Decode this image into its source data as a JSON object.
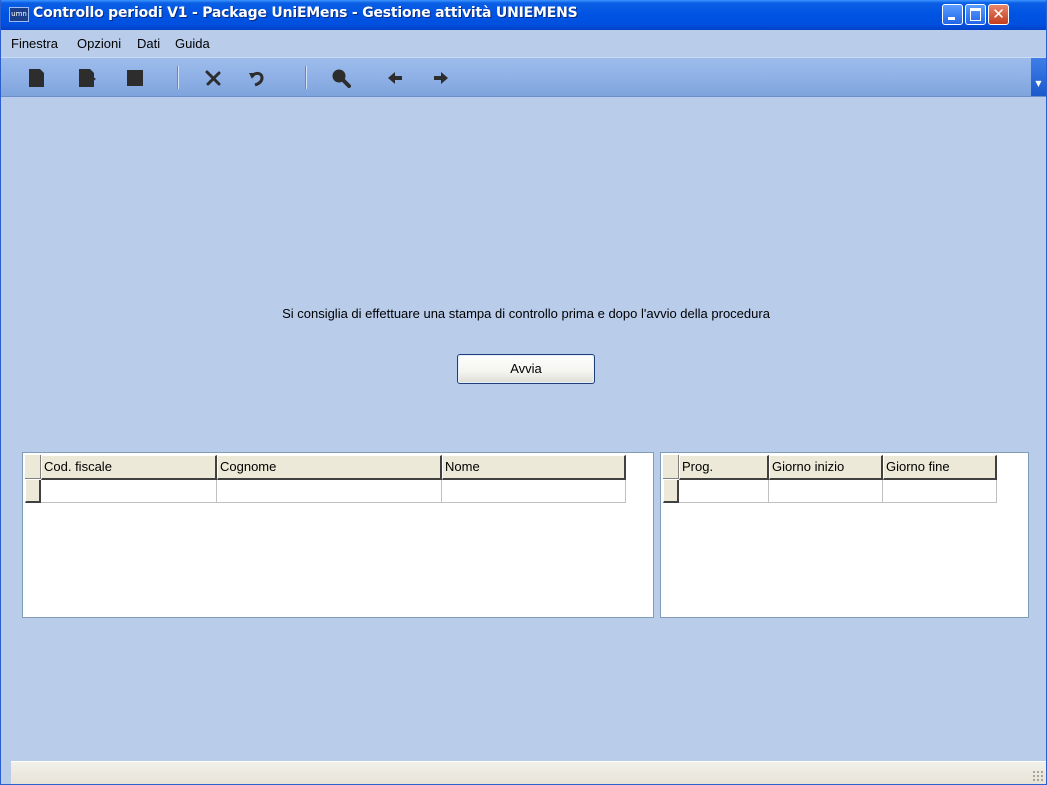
{
  "window": {
    "title": "Controllo periodi V1 - Package UniEMens - Gestione attività UNIEMENS",
    "app_icon_label": "umn",
    "close_symbol": "✕"
  },
  "menubar": {
    "items": [
      "Finestra",
      "Opzioni",
      "Dati",
      "Guida"
    ]
  },
  "toolbar": {
    "icons": [
      "new-record-icon",
      "copy-record-icon",
      "save-icon",
      "delete-icon",
      "undo-icon",
      "search-icon",
      "previous-icon",
      "next-icon"
    ],
    "chevron": "▼"
  },
  "main": {
    "advice": "Si consiglia di effettuare una stampa di controllo prima e dopo l'avvio della procedura",
    "start_button": "Avvia"
  },
  "grid_people": {
    "columns": [
      "Cod. fiscale",
      "Cognome",
      "Nome"
    ],
    "rows": [
      [
        "",
        "",
        ""
      ]
    ]
  },
  "grid_periods": {
    "columns": [
      "Prog.",
      "Giorno inizio",
      "Giorno fine"
    ],
    "rows": [
      [
        "",
        "",
        ""
      ]
    ]
  },
  "colors": {
    "titlebar": "#0054e3",
    "window_background": "#b9cdeb",
    "close_button": "#c33d1e"
  }
}
